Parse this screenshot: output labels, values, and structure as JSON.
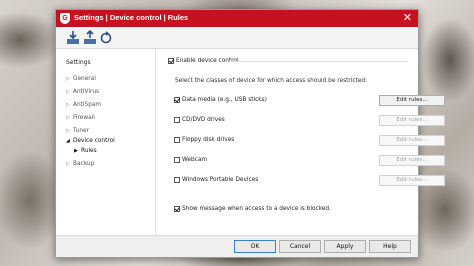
{
  "window": {
    "title": "Settings | Device control | Rules"
  },
  "toolbar": {
    "icons": [
      "import-icon",
      "export-icon",
      "reset-icon"
    ]
  },
  "sidebar": {
    "heading": "Settings",
    "items": [
      {
        "label": "General",
        "expanded": false
      },
      {
        "label": "AntiVirus",
        "expanded": false
      },
      {
        "label": "AntiSpam",
        "expanded": false
      },
      {
        "label": "Firewall",
        "expanded": false
      },
      {
        "label": "Tuner",
        "expanded": false
      },
      {
        "label": "Device control",
        "expanded": true
      },
      {
        "label": "Rules",
        "selected": true
      },
      {
        "label": "Backup",
        "expanded": false
      }
    ]
  },
  "content": {
    "enable_label": "Enable device control",
    "enable_checked": true,
    "instructions": "Select the classes of device for which access should be restricted:",
    "devices": [
      {
        "label": "Data media (e.g., USB sticks)",
        "checked": true,
        "button": "Edit rules...",
        "button_enabled": true
      },
      {
        "label": "CD/DVD drives",
        "checked": false,
        "button": "Edit rules...",
        "button_enabled": false
      },
      {
        "label": "Floppy disk drives",
        "checked": false,
        "button": "Edit rules...",
        "button_enabled": false
      },
      {
        "label": "Webcam",
        "checked": false,
        "button": "Edit rules...",
        "button_enabled": false
      },
      {
        "label": "Windows Portable Devices",
        "checked": false,
        "button": "Edit rules...",
        "button_enabled": false
      }
    ],
    "show_message_label": "Show message when access to a device is blocked.",
    "show_message_checked": true
  },
  "footer": {
    "ok": "OK",
    "cancel": "Cancel",
    "apply": "Apply",
    "help": "Help"
  },
  "colors": {
    "titlebar": "#c8111e",
    "default_button_border": "#3c7fd1"
  }
}
